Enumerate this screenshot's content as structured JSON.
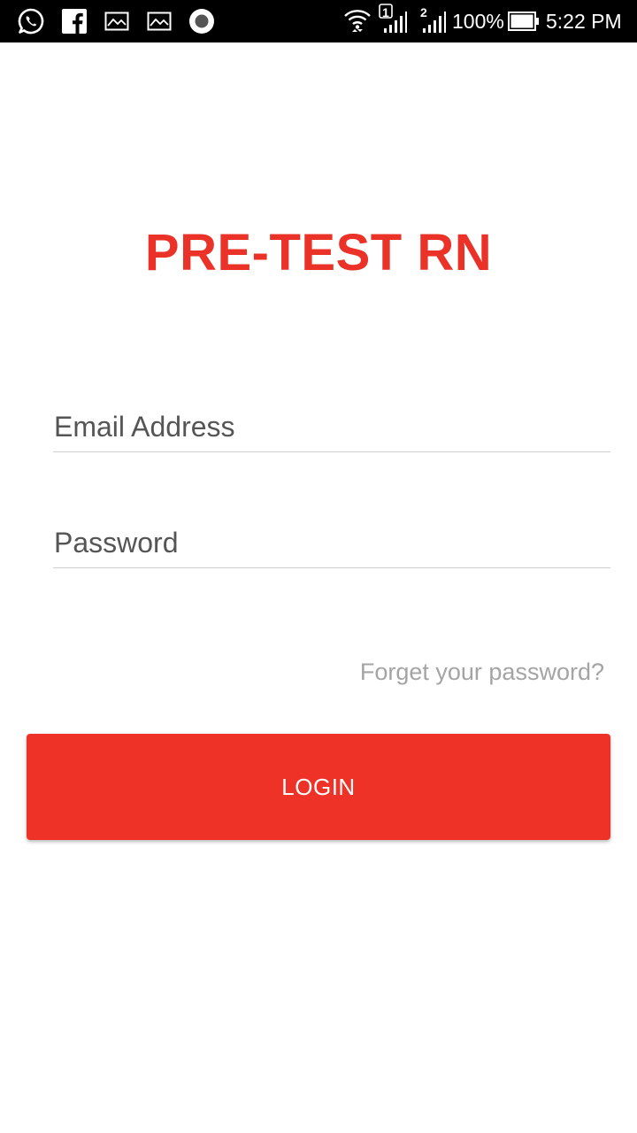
{
  "status_bar": {
    "left_icons": [
      "whatsapp-icon",
      "facebook-icon",
      "image-icon",
      "image-icon",
      "record-icon"
    ],
    "sim1_label": "1",
    "sim2_label": "2",
    "battery_percent": "100%",
    "time": "5:22 PM"
  },
  "app": {
    "title": "PRE-TEST RN"
  },
  "login_form": {
    "email_placeholder": "Email Address",
    "password_placeholder": "Password",
    "forgot_label": "Forget your password?",
    "login_label": "LOGIN"
  },
  "colors": {
    "brand_red": "#ea3229",
    "button_red": "#ee3228",
    "link_gray": "#a4a4a4"
  }
}
